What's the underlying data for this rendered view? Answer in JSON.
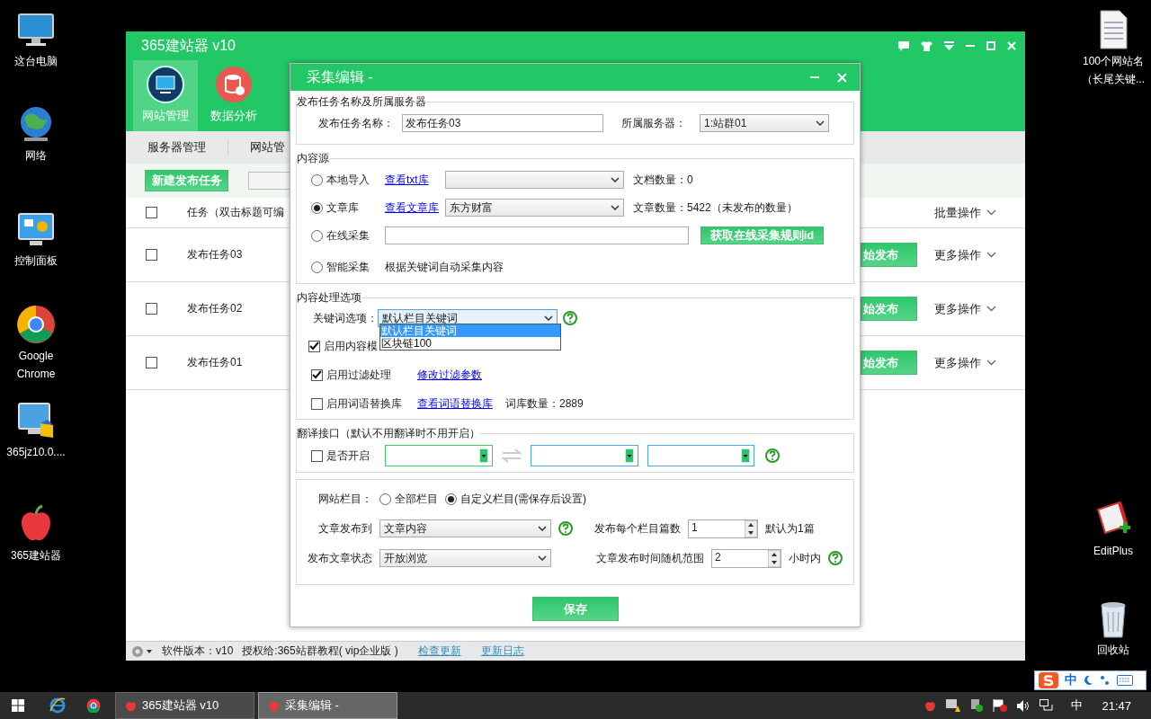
{
  "desktop": {
    "left_icons": [
      {
        "kind": "computer",
        "lines": [
          "这台电脑"
        ]
      },
      {
        "kind": "network",
        "lines": [
          "网络"
        ]
      },
      {
        "kind": "control-panel",
        "lines": [
          "控制面板"
        ]
      },
      {
        "kind": "browser",
        "lines": [
          "Google",
          "Chrome"
        ]
      },
      {
        "kind": "installer",
        "lines": [
          "365jz10.0...."
        ]
      },
      {
        "kind": "app",
        "lines": [
          "365建站器"
        ]
      }
    ],
    "right_icons": [
      {
        "kind": "document",
        "lines": [
          "100个网站名",
          "（长尾关键..."
        ]
      },
      {
        "kind": "editor",
        "lines": [
          "EditPlus"
        ]
      },
      {
        "kind": "recycle-bin",
        "lines": [
          "回收站"
        ]
      }
    ]
  },
  "main_window": {
    "title": "365建站器 v10",
    "nav_tabs": [
      {
        "label": "网站管理",
        "kind": "monitor",
        "selected": true
      },
      {
        "label": "数据分析",
        "kind": "database",
        "selected": false
      }
    ],
    "sub_tabs": [
      "服务器管理",
      "网站管"
    ],
    "new_task_button": "新建发布任务",
    "table": {
      "header_checked": false,
      "header_task": "任务（双击标题可编",
      "header_actions": "批量操作",
      "rows": [
        {
          "checked": false,
          "name": "发布任务03",
          "publish": "始发布",
          "more": "更多操作"
        },
        {
          "checked": false,
          "name": "发布任务02",
          "publish": "始发布",
          "more": "更多操作"
        },
        {
          "checked": false,
          "name": "发布任务01",
          "publish": "始发布",
          "more": "更多操作"
        }
      ]
    },
    "status_bar": {
      "version": "软件版本：v10",
      "license": "授权给:365站群教程( vip企业版 )",
      "links": [
        "检查更新",
        "更新日志"
      ]
    }
  },
  "dialog": {
    "title": "采集编辑 -",
    "task_group": {
      "title": "发布任务名称及所属服务器",
      "name_label": "发布任务名称：",
      "name_value": "发布任务03",
      "server_label": "所属服务器：",
      "server_value": "1:站群01"
    },
    "source_group": {
      "title": "内容源",
      "local": {
        "label": "本地导入",
        "selected": false,
        "link": "查看txt库",
        "count": "文档数量：0"
      },
      "library": {
        "label": "文章库",
        "selected": true,
        "link": "查看文章库",
        "value": "东方财富",
        "count": "文章数量：5422（未发布的数量）"
      },
      "online": {
        "label": "在线采集",
        "selected": false,
        "button": "获取在线采集规则id"
      },
      "smart": {
        "label": "智能采集",
        "selected": false,
        "note": "根据关键词自动采集内容"
      }
    },
    "process_group": {
      "title": "内容处理选项",
      "keyword_label": "关键词选项：",
      "keyword_value": "默认栏目关键词",
      "keyword_options": [
        {
          "label": "默认栏目关键词",
          "selected": true
        },
        {
          "label": "区块链100",
          "selected": false
        }
      ],
      "template": {
        "label": "启用内容模",
        "checked": true
      },
      "filter": {
        "label": "启用过滤处理",
        "checked": true,
        "link": "修改过滤参数"
      },
      "replace": {
        "label": "启用词语替换库",
        "checked": false,
        "link": "查看词语替换库",
        "count": "词库数量：2889"
      }
    },
    "translate_group": {
      "title": "翻译接口（默认不用翻译时不用开启）",
      "enable": {
        "label": "是否开启",
        "checked": false
      }
    },
    "publish_group": {
      "column_label": "网站栏目：",
      "column_options": [
        {
          "label": "全部栏目",
          "selected": false
        },
        {
          "label": "自定义栏目(需保存后设置)",
          "selected": true
        }
      ],
      "target_label": "文章发布到",
      "target_value": "文章内容",
      "per_column_label": "发布每个栏目篇数",
      "per_column_value": "1",
      "per_column_note": "默认为1篇",
      "status_label": "发布文章状态",
      "status_value": "开放浏览",
      "range_label": "文章发布时间随机范围",
      "range_value": "2",
      "range_note": "小时内"
    },
    "save_button": "保存"
  },
  "ime_bar": {
    "mode": "中"
  },
  "taskbar": {
    "tasks": [
      {
        "label": "365建站器 v10",
        "selected": false
      },
      {
        "label": "采集编辑 -",
        "selected": true
      }
    ],
    "input_mode": "中",
    "time": "21:47"
  }
}
